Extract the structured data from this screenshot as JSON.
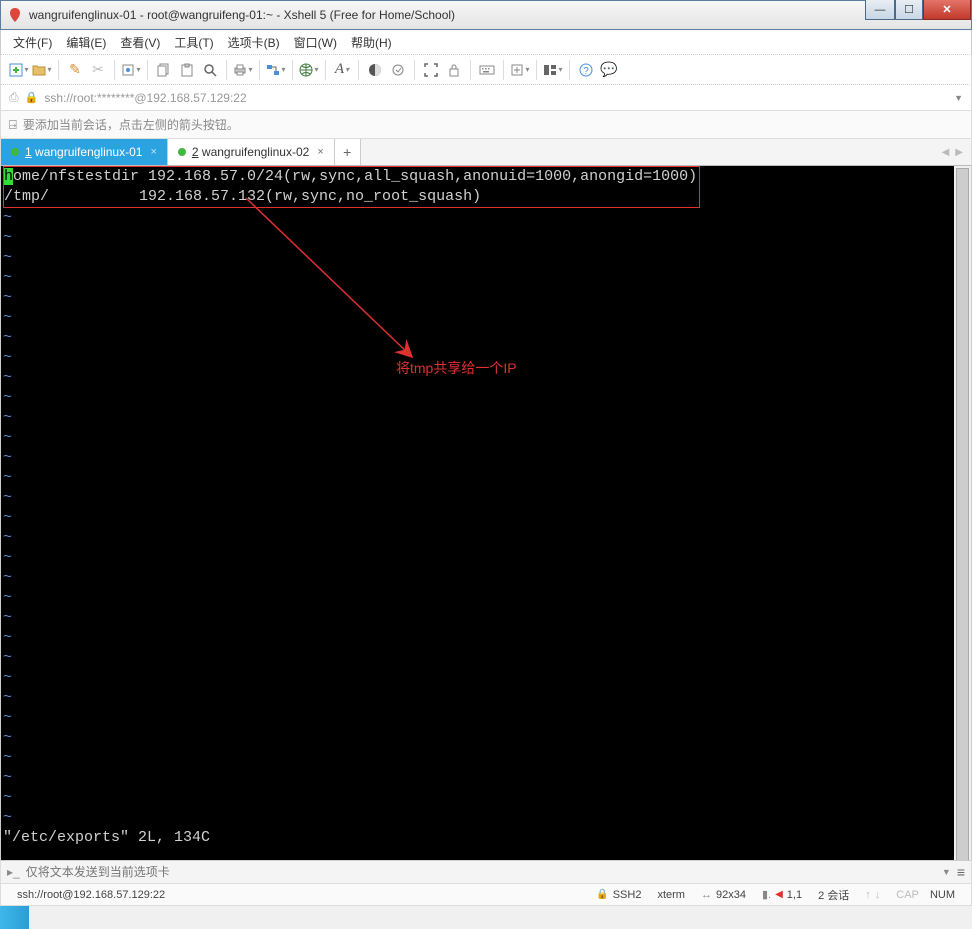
{
  "window": {
    "title": "wangruifenglinux-01 - root@wangruifeng-01:~ - Xshell 5 (Free for Home/School)"
  },
  "menu": {
    "file": "文件(F)",
    "edit": "编辑(E)",
    "view": "查看(V)",
    "tools": "工具(T)",
    "tabs": "选项卡(B)",
    "window": "窗口(W)",
    "help": "帮助(H)"
  },
  "address": {
    "url": "ssh://root:********@192.168.57.129:22"
  },
  "hint": {
    "text": "要添加当前会话，点击左侧的箭头按钮。"
  },
  "tabs": {
    "t1_num": "1",
    "t1_label": "wangruifenglinux-01",
    "t2_num": "2",
    "t2_label": "wangruifenglinux-02"
  },
  "terminal": {
    "line1_pre": "/",
    "line1_cursor": "h",
    "line1_rest": "ome/nfstestdir 192.168.57.0/24(rw,sync,all_squash,anonuid=1000,anongid=1000)",
    "line2": "/tmp/          192.168.57.132(rw,sync,no_root_squash)",
    "annotation": "将tmp共享给一个IP",
    "tilde": "~",
    "status_line": "\"/etc/exports\" 2L, 134C"
  },
  "input": {
    "placeholder": "仅将文本发送到当前选项卡"
  },
  "status": {
    "conn": "ssh://root@192.168.57.129:22",
    "proto": "SSH2",
    "term": "xterm",
    "size": "92x34",
    "pos": "1,1",
    "sessions": "2 会话",
    "cap": "CAP",
    "num": "NUM"
  }
}
